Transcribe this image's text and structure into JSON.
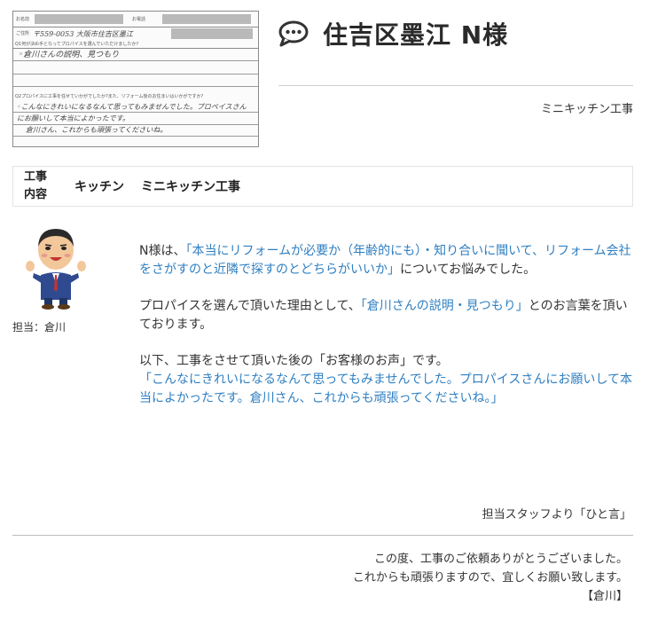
{
  "survey": {
    "name_label": "お名前",
    "phone_label": "お電話",
    "address_label": "ご住所",
    "address_hand": "〒559-0053 大阪市住吉区墨江",
    "q1_label": "Q1何が決め手となってプロパイスを選んでいただけましたか?",
    "q1_hand": "◦倉川さんの説明、見つもり",
    "q2_label": "Q2プロパイスに工事を任せていかがでしたか?また、リフォーム後のお住まいはいかがですか?",
    "q2_hand_1": "◦こんなにきれいになるなんて思ってもみませんでした。プロペイスさん",
    "q2_hand_2": "にお願いして本当によかったです。",
    "q2_hand_3": "倉川さん、これからも頑張ってくださいね。"
  },
  "header": {
    "title": "住吉区墨江 N様",
    "subtitle": "ミニキッチン工事"
  },
  "work": {
    "label_1": "工事",
    "label_2": "内容",
    "category": "キッチン",
    "name": "ミニキッチン工事"
  },
  "staff": {
    "label": "担当：倉川"
  },
  "content": {
    "p1_a": "N様は、",
    "p1_hl": "「本当にリフォームが必要か（年齢的にも）・知り合いに聞いて、リフォーム会社をさがすのと近隣で探すのとどちらがいいか」",
    "p1_b": "についてお悩みでした。",
    "p2_a": "プロパイスを選んで頂いた理由として、",
    "p2_hl": "「倉川さんの説明・見つもり」",
    "p2_b": "とのお言葉を頂いております。",
    "p3_a": "以下、工事をさせて頂いた後の「お客様のお声」です。",
    "p3_hl": "「こんなにきれいになるなんて思ってもみませんでした。プロパイスさんにお願いして本当によかったです。倉川さん、これからも頑張ってくださいね。」"
  },
  "footer": {
    "hitokoto": "担当スタッフより「ひと言」",
    "msg_1": "この度、工事のご依頼ありがとうございました。",
    "msg_2": "これからも頑張りますので、宜しくお願い致します。",
    "msg_3": "【倉川】"
  },
  "colors": {
    "highlight": "#2f7fc1",
    "text": "#333333"
  }
}
